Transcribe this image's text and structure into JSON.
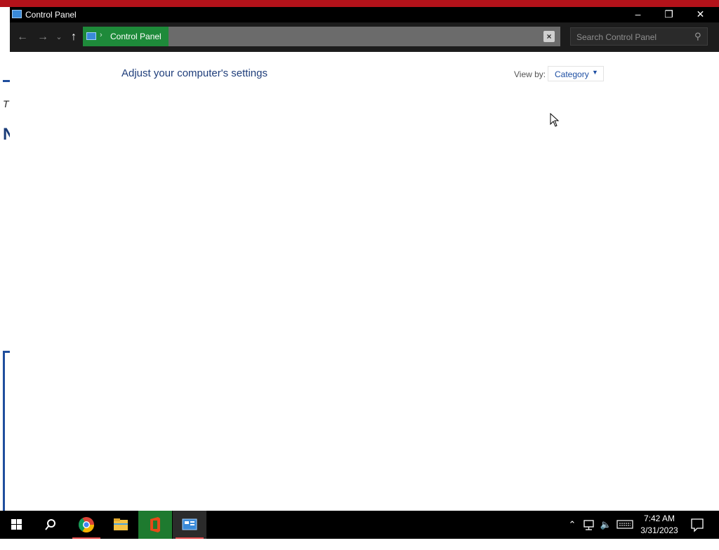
{
  "window": {
    "title": "Control Panel",
    "controls": {
      "minimize": "–",
      "maximize": "❐",
      "close": "✕"
    }
  },
  "navigation": {
    "breadcrumb": "Control Panel",
    "search_placeholder": "Search Control Panel"
  },
  "content": {
    "heading": "Adjust your computer's settings",
    "view_by_label": "View by:",
    "view_by_value": "Category"
  },
  "taskbar": {
    "items": [
      "start-icon",
      "search-icon",
      "chrome-icon",
      "file-explorer-icon",
      "office-icon",
      "control-panel-icon"
    ],
    "clock_time": "7:42 AM",
    "clock_date": "3/31/2023"
  },
  "colors": {
    "titlebar": "#000000",
    "navbar": "#1c1c1c",
    "breadcrumb_highlight": "#1e8a3a",
    "heading": "#1e3d7a",
    "link": "#1e4fa3",
    "taskbar": "#000000"
  }
}
